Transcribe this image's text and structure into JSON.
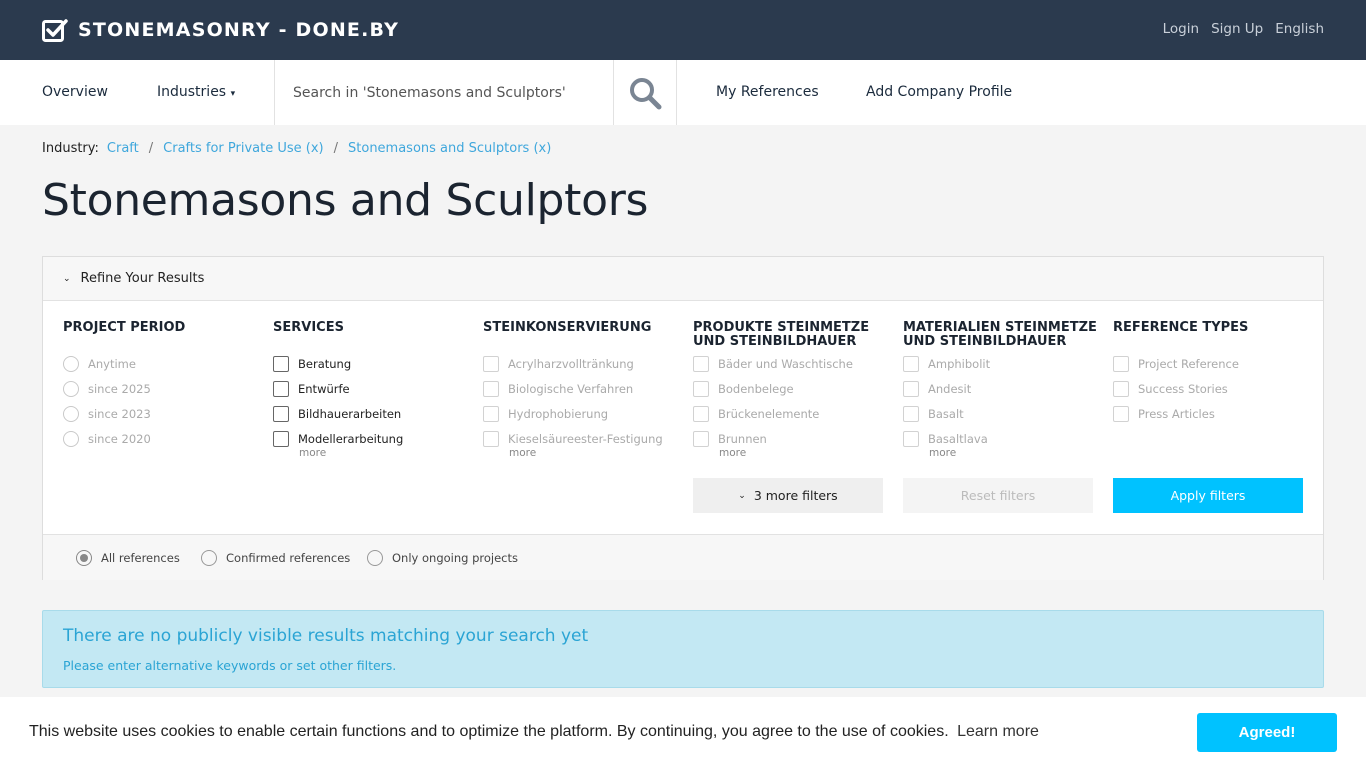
{
  "header": {
    "brand": "STONEMASONRY - DONE.BY",
    "links": [
      "Login",
      "Sign Up",
      "English"
    ]
  },
  "nav": {
    "overview": "Overview",
    "industries": "Industries",
    "search_placeholder": "Search in 'Stonemasons and Sculptors'",
    "my_references": "My References",
    "add_company": "Add Company Profile"
  },
  "breadcrumb": {
    "label": "Industry:",
    "items": [
      "Craft",
      "Crafts for Private Use (x)",
      "Stonemasons and Sculptors (x)"
    ],
    "separator": "/"
  },
  "page_title": "Stonemasons and Sculptors",
  "filters": {
    "heading": "Refine Your Results",
    "project_period": {
      "title": "PROJECT PERIOD",
      "options": [
        "Anytime",
        "since 2025",
        "since 2023",
        "since 2020"
      ]
    },
    "services": {
      "title": "SERVICES",
      "options": [
        "Beratung",
        "Entwürfe",
        "Bildhauerarbeiten",
        "Modellerarbeitung"
      ],
      "more": "more"
    },
    "steinkonservierung": {
      "title": "STEINKONSERVIERUNG",
      "options": [
        "Acrylharzvolltränkung",
        "Biologische Verfahren",
        "Hydrophobierung",
        "Kieselsäureester-Festigung"
      ],
      "more": "more"
    },
    "produkte": {
      "title": "PRODUKTE STEINMETZE UND STEINBILDHAUER",
      "options": [
        "Bäder und Waschtische",
        "Bodenbelege",
        "Brückenelemente",
        "Brunnen"
      ],
      "more": "more"
    },
    "materialien": {
      "title": "MATERIALIEN STEINMETZE UND STEINBILDHAUER",
      "options": [
        "Amphibolit",
        "Andesit",
        "Basalt",
        "Basaltlava"
      ],
      "more": "more"
    },
    "reference_types": {
      "title": "REFERENCE TYPES",
      "options": [
        "Project Reference",
        "Success Stories",
        "Press Articles"
      ]
    },
    "more_filters": "3 more filters",
    "reset": "Reset filters",
    "apply": "Apply filters",
    "scope": [
      "All references",
      "Confirmed references",
      "Only ongoing projects"
    ]
  },
  "alert": {
    "title": "There are no publicly visible results matching your search yet",
    "text": "Please enter alternative keywords or set other filters."
  },
  "cookie": {
    "text": "This website uses cookies to enable certain functions and to optimize the platform. By continuing, you agree to the use of cookies.",
    "link": "Learn more",
    "button": "Agreed!"
  },
  "colors": {
    "topbar": "#2b3a4e",
    "accent": "#00c2ff",
    "link": "#3fa7dc",
    "alert_bg": "#c3e8f3"
  }
}
